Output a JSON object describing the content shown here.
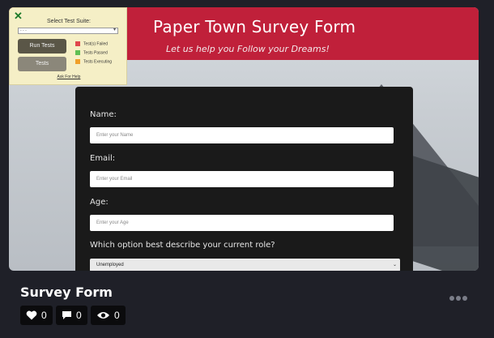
{
  "preview": {
    "header_title": "Paper Town Survey Form",
    "header_subtitle": "Let us help you Follow your Dreams!",
    "test_suite": {
      "close": "✕",
      "label": "Select Test Suite:",
      "select_value": "- - -",
      "run_label": "Run Tests",
      "tests_label": "Tests",
      "legend": [
        "Test(s) Failed",
        "Tests Passed",
        "Tests Executing"
      ],
      "legend_colors": [
        "#e0474c",
        "#5fbf53",
        "#f0a02a"
      ],
      "help": "Ask For Help"
    },
    "form": {
      "name_label": "Name:",
      "name_placeholder": "Enter your Name",
      "email_label": "Email:",
      "email_placeholder": "Enter your Email",
      "age_label": "Age:",
      "age_placeholder": "Enter your Age",
      "role_label": "Which option best describe your current role?",
      "role_value": "Unemployed"
    }
  },
  "card": {
    "title": "Survey Form",
    "likes": "0",
    "comments": "0",
    "views": "0"
  }
}
